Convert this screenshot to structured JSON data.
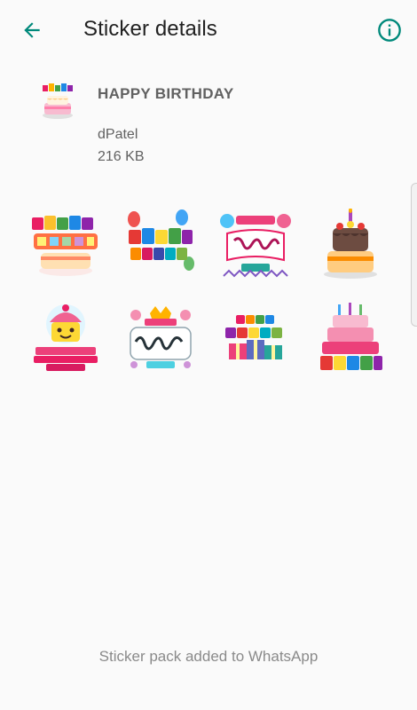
{
  "toolbar": {
    "title": "Sticker details",
    "back_icon": "arrow-left-icon",
    "info_icon": "info-circle-icon",
    "accent_color": "#00897b"
  },
  "pack": {
    "name": "HAPPY BIRTHDAY",
    "publisher": "dPatel",
    "size": "216 KB",
    "tray_icon": "birthday-cake-icon"
  },
  "stickers": [
    {
      "icon": "happy-birthday-cake-sticker"
    },
    {
      "icon": "happy-birthday-balloons-sticker"
    },
    {
      "icon": "birthday-to-you-banner-sticker"
    },
    {
      "icon": "chocolate-cake-sticker"
    },
    {
      "icon": "cupcake-happy-birthday-to-you-sticker"
    },
    {
      "icon": "birthday-crown-badge-sticker"
    },
    {
      "icon": "happy-birthday-gifts-sticker"
    },
    {
      "icon": "pink-cake-happy-birthday-sticker"
    }
  ],
  "footer": {
    "status": "Sticker pack added to WhatsApp"
  }
}
